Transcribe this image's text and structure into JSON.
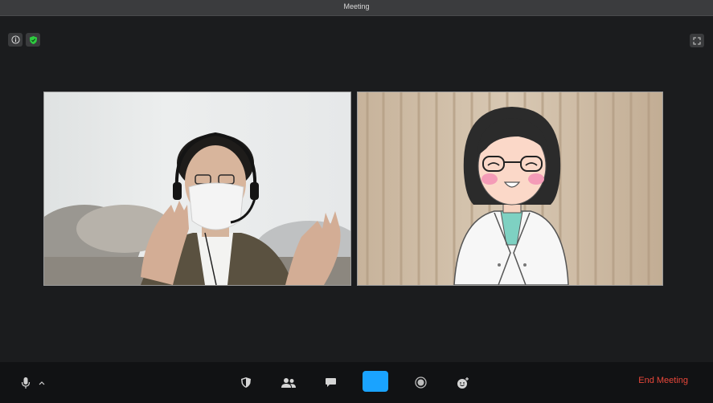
{
  "window": {
    "title": "Meeting"
  },
  "toolbar": {
    "end_label": "End Meeting"
  },
  "colors": {
    "share_accent": "#1aa3ff",
    "end_red": "#e8473a",
    "shield_green": "#2ecc40"
  },
  "icons": [
    "info-icon",
    "shield-icon",
    "fullscreen-icon",
    "mic-icon",
    "chevron-up-icon",
    "security-icon",
    "participants-icon",
    "chat-icon",
    "share-screen-icon",
    "record-icon",
    "reactions-icon"
  ]
}
